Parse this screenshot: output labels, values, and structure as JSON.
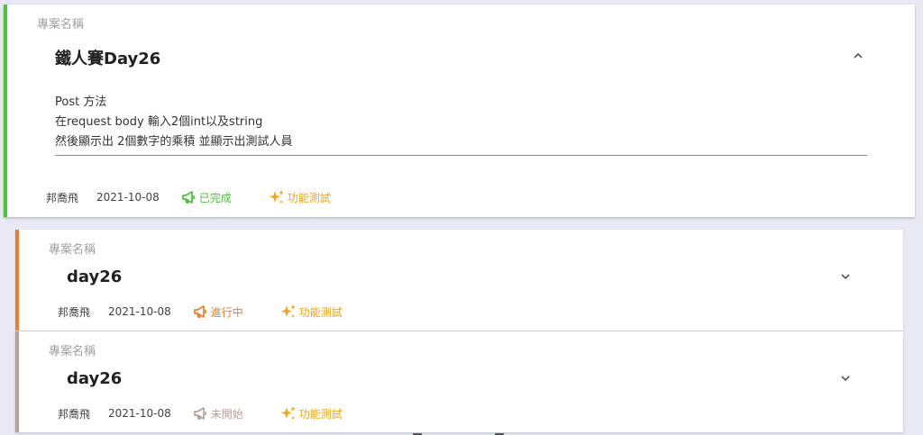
{
  "colors": {
    "completed": "#4cc13a",
    "in_progress": "#ee7d27",
    "not_started": "#b8a198",
    "tag": "#f6a313"
  },
  "cards": [
    {
      "section_label": "專案名稱",
      "title": "鐵人賽Day26",
      "expanded": true,
      "chevron_icon": "chevron-up-icon",
      "description": [
        "Post 方法",
        "在request body 輸入2個int以及string",
        "然後顯示出 2個數字的乘積 並顯示出測試人員"
      ],
      "author": "邦喬飛",
      "date": "2021-10-08",
      "status": "已完成",
      "status_icon": "megaphone-icon",
      "tag": "功能測試",
      "tag_icon": "sparkles-icon"
    },
    {
      "section_label": "專案名稱",
      "title": "day26",
      "expanded": false,
      "chevron_icon": "chevron-down-icon",
      "author": "邦喬飛",
      "date": "2021-10-08",
      "status": "進行中",
      "status_icon": "megaphone-icon",
      "tag": "功能測試",
      "tag_icon": "sparkles-icon"
    },
    {
      "section_label": "專案名稱",
      "title": "day26",
      "expanded": false,
      "chevron_icon": "chevron-down-icon",
      "author": "邦喬飛",
      "date": "2021-10-08",
      "status": "未開始",
      "status_icon": "megaphone-icon",
      "tag": "功能測試",
      "tag_icon": "sparkles-icon"
    }
  ]
}
